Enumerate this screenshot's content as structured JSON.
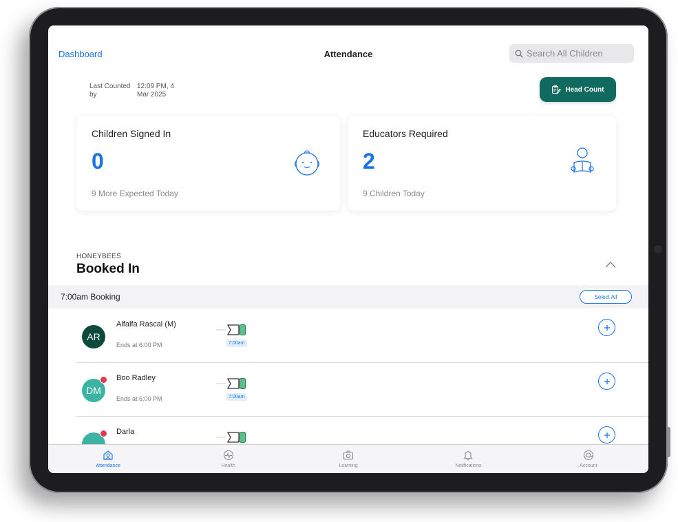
{
  "header": {
    "back_label": "Dashboard",
    "title": "Attendance",
    "search_placeholder": "Search All Children"
  },
  "last_counted": {
    "label": "Last Counted by",
    "value": "12:09 PM, 4 Mar 2025"
  },
  "head_count_label": "Head Count",
  "cards": [
    {
      "title": "Children Signed In",
      "value": "0",
      "subtitle": "9 More Expected Today",
      "icon": "baby-face-icon"
    },
    {
      "title": "Educators Required",
      "value": "2",
      "subtitle": "9 Children Today",
      "icon": "educator-reading-icon"
    }
  ],
  "section": {
    "room": "HONEYBEES",
    "title": "Booked In"
  },
  "booking": {
    "label": "7:00am Booking",
    "select_all_label": "Select All"
  },
  "children": [
    {
      "initials": "AR",
      "name": "Alfalfa Rascal (M)",
      "ends": "Ends at 6:00 PM",
      "time": "7:00am",
      "avatar_color": "#0d4a3c",
      "alert": false
    },
    {
      "initials": "DM",
      "name": "Boo Radley",
      "ends": "Ends at 6:00 PM",
      "time": "7:00am",
      "avatar_color": "#3db3a3",
      "alert": true
    },
    {
      "initials": "",
      "name": "Darla",
      "ends": "",
      "time": "",
      "avatar_color": "#3db3a3",
      "alert": true
    }
  ],
  "tabs": [
    {
      "label": "Attendance",
      "icon": "attendance-icon",
      "active": true
    },
    {
      "label": "Health",
      "icon": "health-icon",
      "active": false
    },
    {
      "label": "Learning",
      "icon": "camera-icon",
      "active": false
    },
    {
      "label": "Notifications",
      "icon": "bell-icon",
      "active": false
    },
    {
      "label": "Account",
      "icon": "account-icon",
      "active": false
    }
  ],
  "colors": {
    "accent": "#1a73e8",
    "head_count_bg": "#106a5f",
    "alert": "#e53950"
  }
}
